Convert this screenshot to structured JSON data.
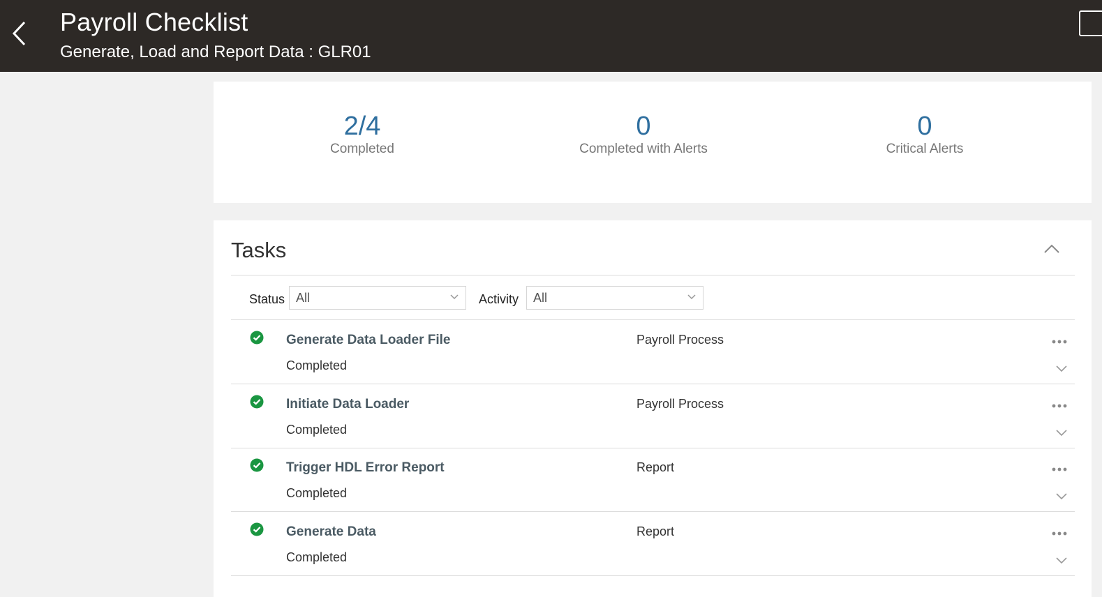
{
  "header": {
    "title": "Payroll Checklist",
    "subtitle": "Generate, Load and Report Data : GLR01",
    "back_icon": "chevron-left-icon"
  },
  "summary": {
    "metrics": [
      {
        "value": "2/4",
        "label": "Completed"
      },
      {
        "value": "0",
        "label": "Completed with Alerts"
      },
      {
        "value": "0",
        "label": "Critical Alerts"
      }
    ],
    "value_color": "#2f6f9f"
  },
  "tasks": {
    "title": "Tasks",
    "collapse_icon": "chevron-up-icon",
    "filters": {
      "status": {
        "label": "Status",
        "value": "All"
      },
      "activity": {
        "label": "Activity",
        "value": "All"
      }
    },
    "status_color": "#1a9641",
    "rows": [
      {
        "name": "Generate Data Loader File",
        "status": "Completed",
        "activity": "Payroll Process"
      },
      {
        "name": "Initiate Data Loader",
        "status": "Completed",
        "activity": "Payroll Process"
      },
      {
        "name": "Trigger HDL Error Report",
        "status": "Completed",
        "activity": "Report"
      },
      {
        "name": "Generate Data",
        "status": "Completed",
        "activity": "Report"
      }
    ]
  }
}
